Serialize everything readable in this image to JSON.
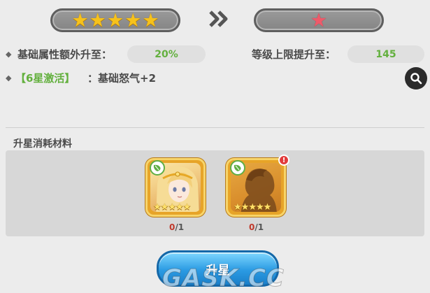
{
  "star_upgrade": {
    "current_stars": 5,
    "next_stars": 1,
    "arrow_icon": "double-chevron-right-icon",
    "colors": {
      "gold_star": "#f6c21b",
      "red_star": "#ef5a6a",
      "highlight_green": "#63b03e"
    }
  },
  "stats": {
    "base_attr_label": "基础属性额外升至：",
    "base_attr_value": "20%",
    "level_cap_label": "等级上限提升至：",
    "level_cap_value": "145",
    "activate_tag": "【6星激活】",
    "activate_text": "：基础怒气+2"
  },
  "materials": {
    "section_title": "升星消耗材料",
    "items": [
      {
        "count": "0",
        "total": "/1",
        "stars": 5,
        "badge": "leaf-icon",
        "alert": false
      },
      {
        "count": "0",
        "total": "/1",
        "stars": 5,
        "badge": "leaf-icon",
        "alert": true,
        "alert_text": "!"
      }
    ]
  },
  "actions": {
    "upgrade_label": "升星"
  },
  "watermark": "GASK.CC"
}
